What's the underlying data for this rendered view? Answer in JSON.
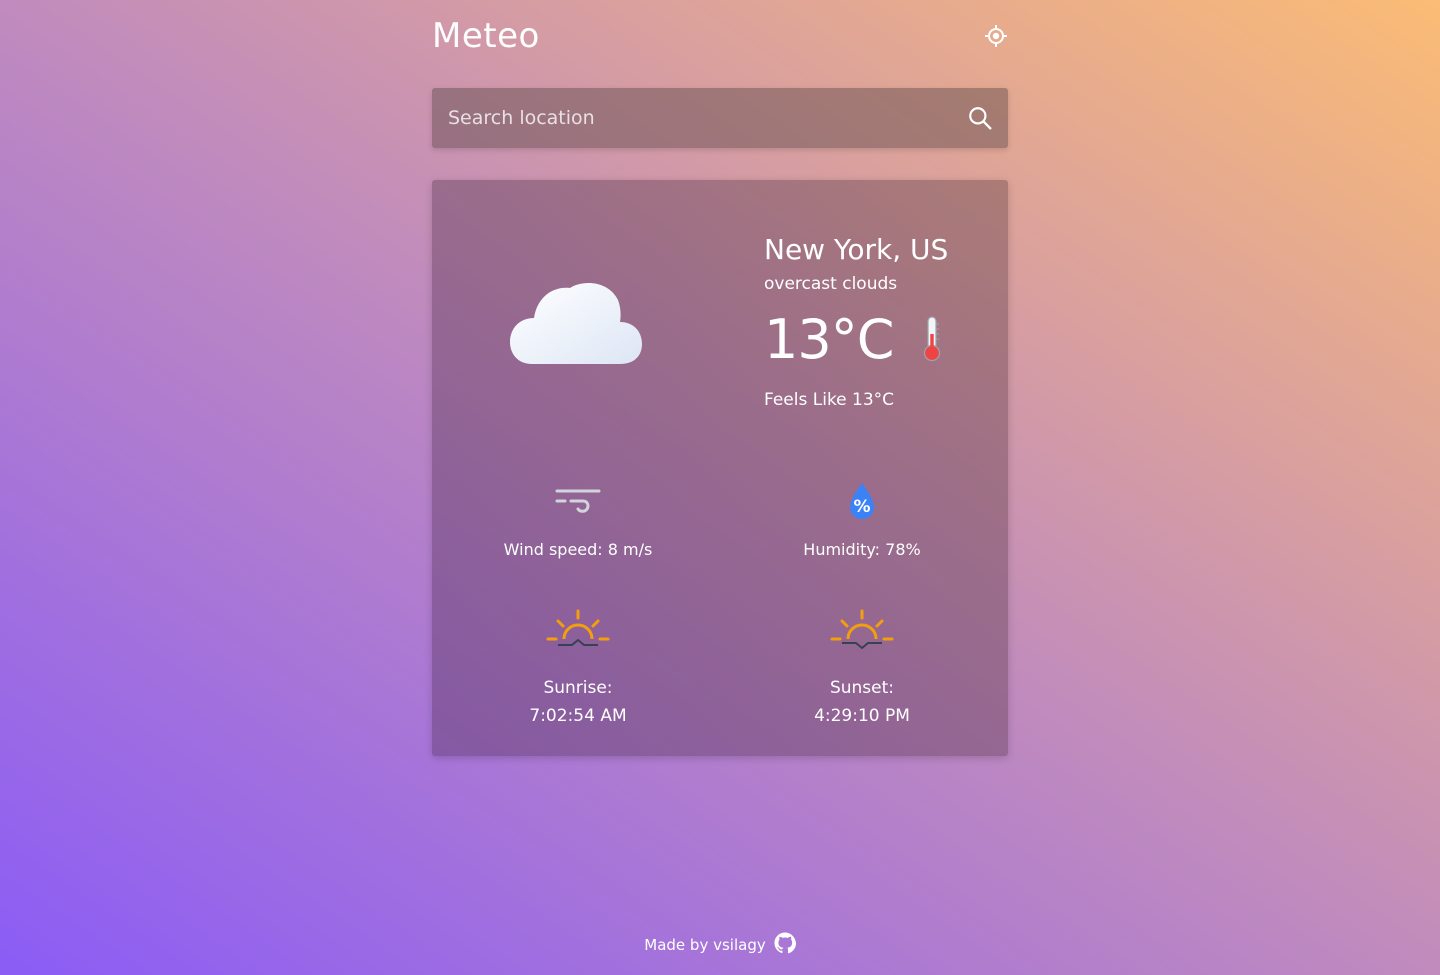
{
  "header": {
    "title": "Meteo",
    "locate_icon": "crosshair-icon"
  },
  "search": {
    "placeholder": "Search location",
    "value": "",
    "icon": "search-icon"
  },
  "weather": {
    "city": "New York, US",
    "description": "overcast clouds",
    "temperature": "13°C",
    "feels_like": "Feels Like 13°C",
    "icon": "cloud-icon"
  },
  "stats": {
    "wind": {
      "label": "Wind speed: 8 m/s",
      "icon": "wind-icon"
    },
    "humidity": {
      "label": "Humidity: 78%",
      "icon": "humidity-icon"
    },
    "sunrise": {
      "label": "Sunrise:",
      "time": "7:02:54 AM",
      "icon": "sunrise-icon"
    },
    "sunset": {
      "label": "Sunset:",
      "time": "4:29:10 PM",
      "icon": "sunset-icon"
    }
  },
  "footer": {
    "text": "Made by vsilagy",
    "icon": "github-icon"
  },
  "colors": {
    "sun_accent": "#f59e0b",
    "water_blue": "#3b82f6",
    "thermo_red": "#ef4444"
  }
}
